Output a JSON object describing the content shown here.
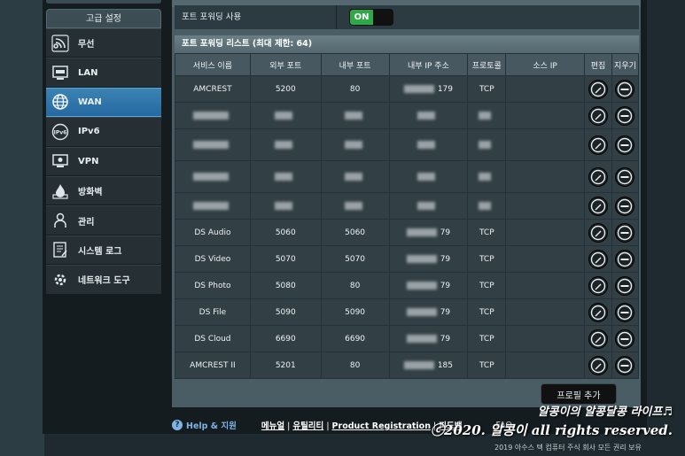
{
  "sidebar": {
    "header": "고급 설정",
    "items": [
      {
        "label": "무선",
        "icon": "wireless-icon"
      },
      {
        "label": "LAN",
        "icon": "lan-icon"
      },
      {
        "label": "WAN",
        "icon": "wan-globe-icon",
        "active": true
      },
      {
        "label": "IPv6",
        "icon": "ipv6-icon"
      },
      {
        "label": "VPN",
        "icon": "vpn-icon"
      },
      {
        "label": "방화벽",
        "icon": "firewall-icon"
      },
      {
        "label": "관리",
        "icon": "admin-icon"
      },
      {
        "label": "시스템 로그",
        "icon": "system-log-icon"
      },
      {
        "label": "네트워크 도구",
        "icon": "network-tools-icon"
      }
    ]
  },
  "port_forwarding": {
    "enable_label": "포트 포워딩 사용",
    "toggle_state": "ON",
    "list_title": "포트 포워딩 리스트 (최대 제한: 64)",
    "columns": [
      "서비스 이름",
      "외부 포트",
      "내부 포트",
      "내부 IP 주소",
      "프로토콜",
      "소스 IP",
      "편집",
      "지우기"
    ],
    "rows": [
      {
        "service": "AMCREST",
        "ext": "5200",
        "int": "80",
        "ip": "179",
        "proto": "TCP"
      },
      {
        "service": "",
        "ext": "",
        "int": "",
        "ip": "",
        "proto": ""
      },
      {
        "service": "",
        "ext": "",
        "int": "",
        "ip": "",
        "proto": ""
      },
      {
        "service": "",
        "ext": "",
        "int": "",
        "ip": "",
        "proto": ""
      },
      {
        "service": "",
        "ext": "",
        "int": "",
        "ip": "",
        "proto": ""
      },
      {
        "service": "DS Audio",
        "ext": "5060",
        "int": "5060",
        "ip": "79",
        "proto": "TCP"
      },
      {
        "service": "DS Video",
        "ext": "5070",
        "int": "5070",
        "ip": "79",
        "proto": "TCP"
      },
      {
        "service": "DS Photo",
        "ext": "5080",
        "int": "80",
        "ip": "79",
        "proto": "TCP"
      },
      {
        "service": "DS File",
        "ext": "5090",
        "int": "5090",
        "ip": "79",
        "proto": "TCP"
      },
      {
        "service": "DS Cloud",
        "ext": "6690",
        "int": "6690",
        "ip": "79",
        "proto": "TCP"
      },
      {
        "service": "AMCREST II",
        "ext": "5201",
        "int": "80",
        "ip": "185",
        "proto": "TCP"
      }
    ],
    "add_button": "프로필 추가"
  },
  "footer": {
    "help": "Help & 지원",
    "link1": "메뉴얼",
    "link2": "유틸리티",
    "link3": "Product Registration",
    "link4": "피드백",
    "faq": "FAQ",
    "copyright": "2019 아수스 텍 컴퓨터 주식 회사 모든 권리 보유"
  },
  "watermark": {
    "line1": "알콩이의 알콩달콩 라이프♬",
    "line2": "ⓒ2020. 알콩이 all rights reserved."
  },
  "colors": {
    "accent": "#2569a0",
    "toggle_on": "#2fa84a"
  }
}
